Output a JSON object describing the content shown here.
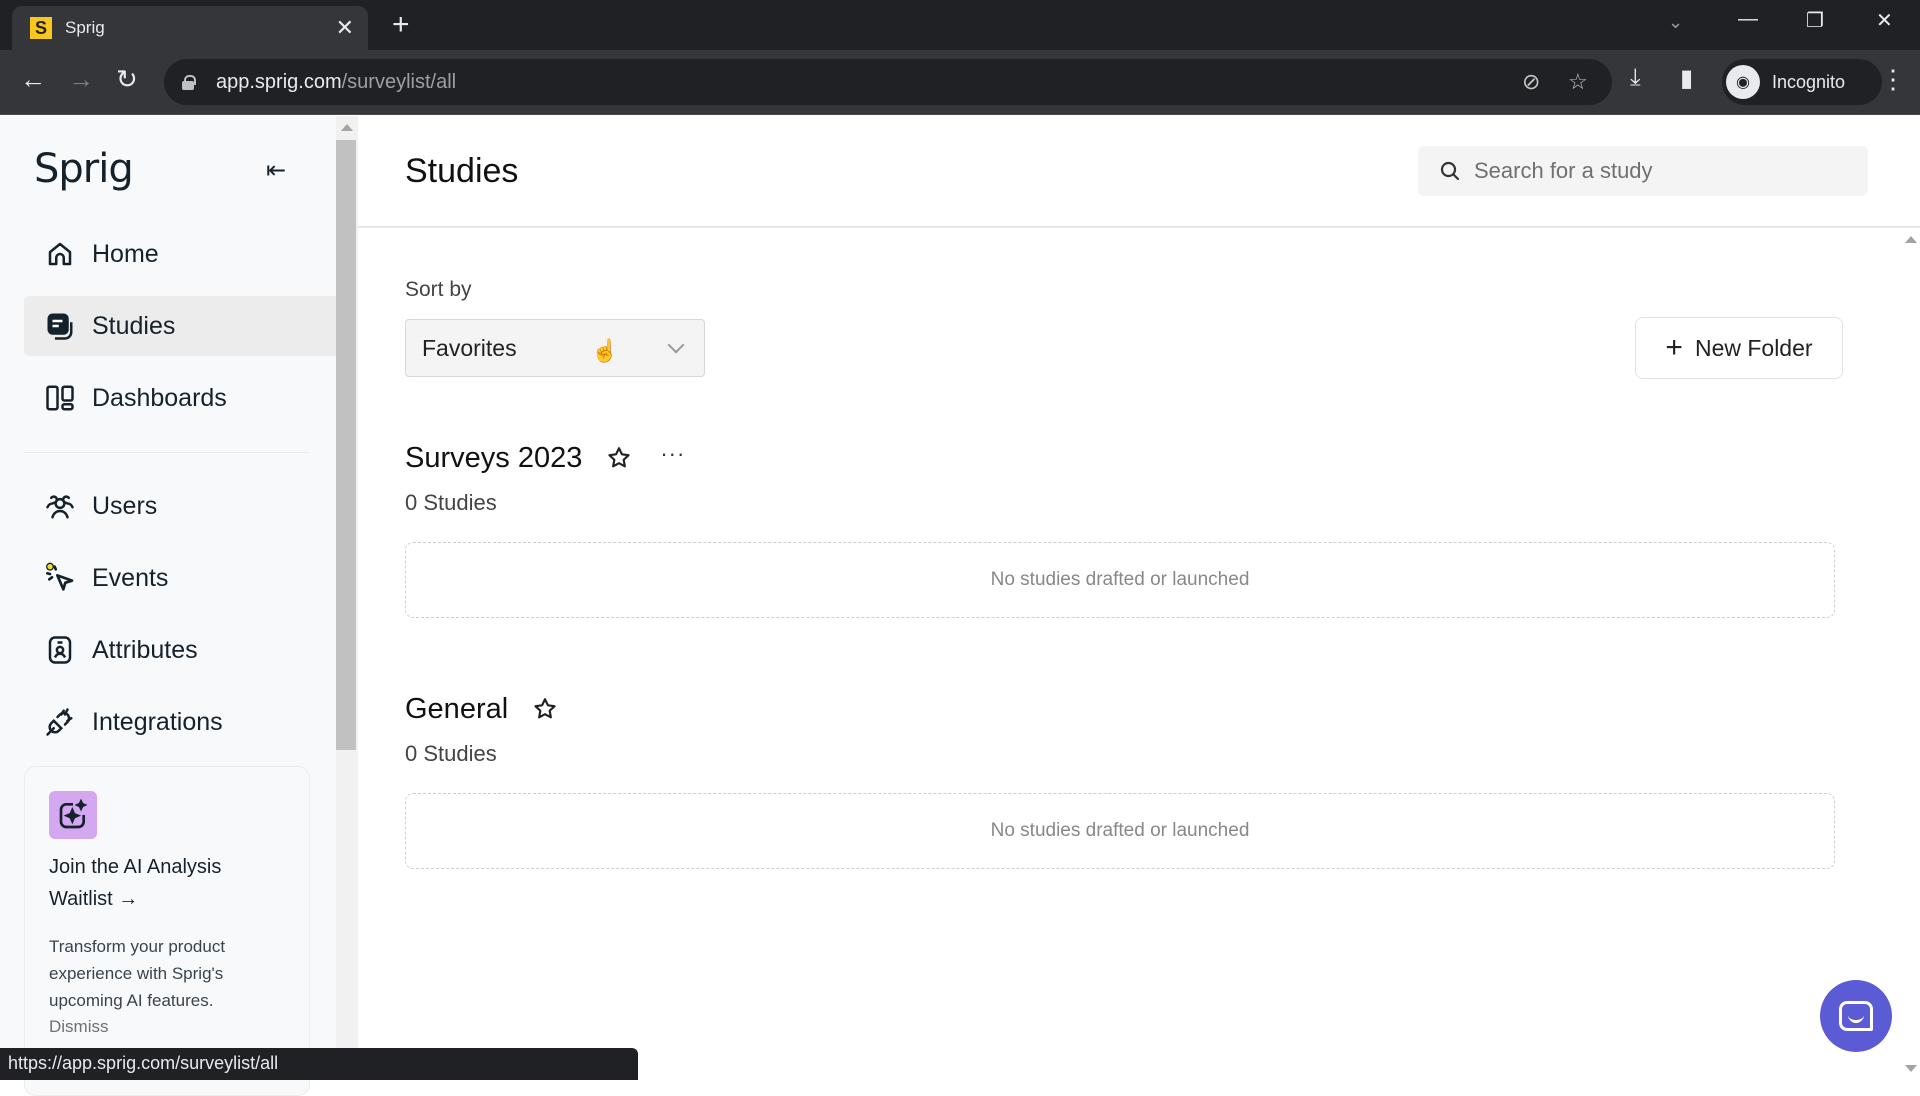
{
  "browser": {
    "tab_title": "Sprig",
    "tab_favicon_letter": "S",
    "url_host": "app.sprig.com",
    "url_path": "/surveylist/all",
    "profile_label": "Incognito",
    "status_url": "https://app.sprig.com/surveylist/all",
    "icons": {
      "back": "←",
      "forward": "→",
      "reload": "↻",
      "new_tab": "+",
      "close": "✕",
      "tab_search": "⌄",
      "minimize": "—",
      "restore": "❐",
      "win_close": "✕",
      "eye_off": "⊘",
      "bookmark": "☆",
      "download": "⤓",
      "sidepanel": "▮",
      "menu": "⋮"
    }
  },
  "sidebar": {
    "logo": "Sprig",
    "collapse_icon": "⇤",
    "items": [
      {
        "label": "Home",
        "icon": "home-icon",
        "active": false
      },
      {
        "label": "Studies",
        "icon": "studies-icon",
        "active": true
      },
      {
        "label": "Dashboards",
        "icon": "dashboards-icon",
        "active": false
      },
      {
        "label": "Users",
        "icon": "users-icon",
        "active": false
      },
      {
        "label": "Events",
        "icon": "events-icon",
        "active": false
      },
      {
        "label": "Attributes",
        "icon": "attributes-icon",
        "active": false
      },
      {
        "label": "Integrations",
        "icon": "integrations-icon",
        "active": false
      }
    ],
    "promo": {
      "title": "Join the AI Analysis Waitlist →",
      "body": "Transform your product experience with Sprig's upcoming AI features.",
      "dismiss": "Dismiss",
      "icon_color": "#d4a8f0"
    }
  },
  "main": {
    "title": "Studies",
    "search_placeholder": "Search for a study",
    "sort_label": "Sort by",
    "sort_value": "Favorites",
    "new_folder_label": "New Folder",
    "folders": [
      {
        "name": "Surveys 2023",
        "count": "0 Studies",
        "empty_text": "No studies drafted or launched",
        "has_menu": true,
        "more_label": "···"
      },
      {
        "name": "General",
        "count": "0 Studies",
        "empty_text": "No studies drafted or launched",
        "has_menu": false
      }
    ]
  },
  "colors": {
    "accent_chat": "#5b5bd6",
    "events_dot": "#f1e027",
    "text_dark": "#16222b"
  }
}
